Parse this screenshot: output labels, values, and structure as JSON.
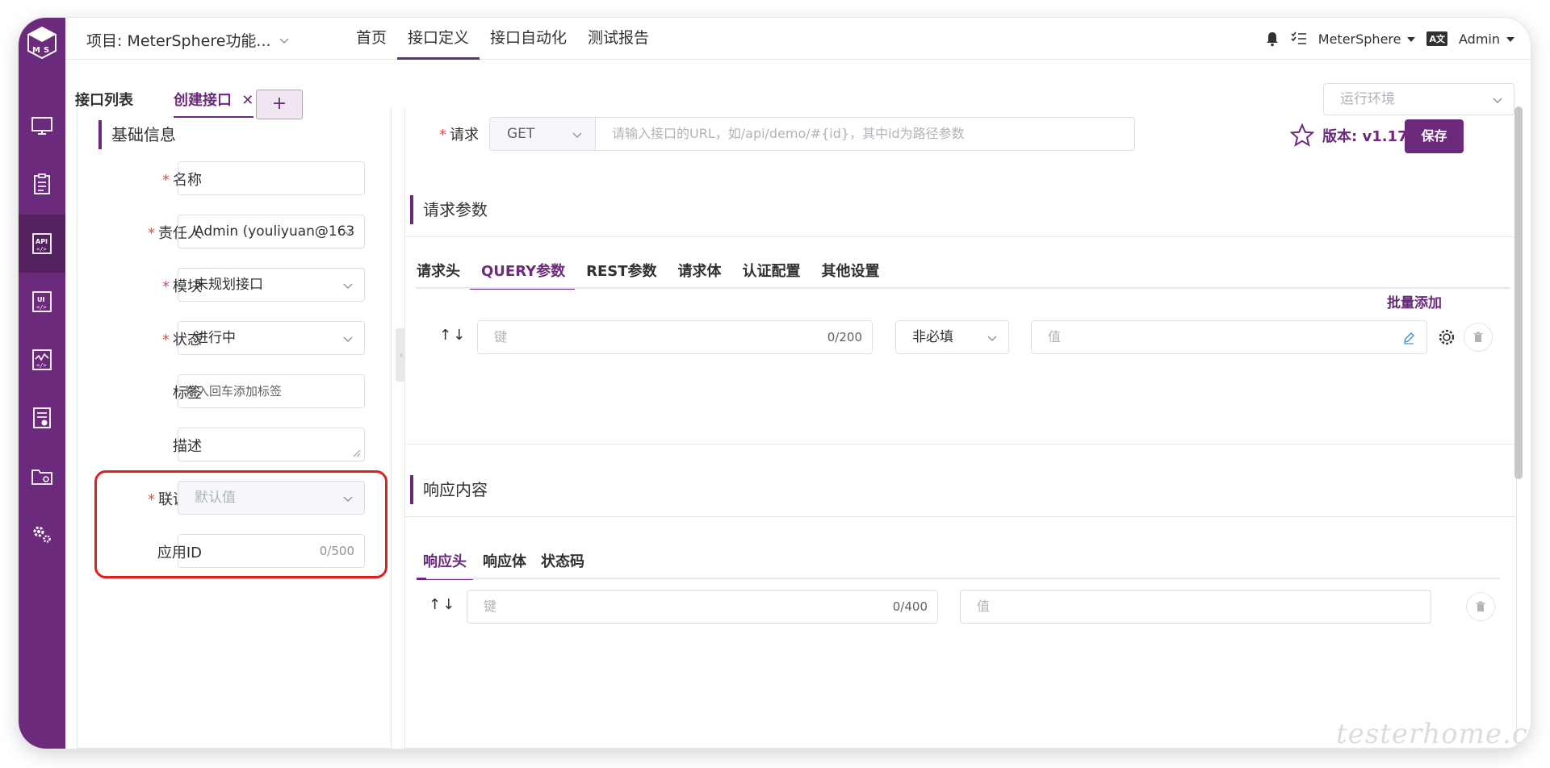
{
  "app": {
    "brand_color": "#6b2a7c",
    "sidebar_icons": [
      "monitor-icon",
      "clipboard-icon",
      "api-icon",
      "ui-icon",
      "performance-icon",
      "report-icon",
      "folder-icon",
      "settings-icon"
    ]
  },
  "header": {
    "project": "项目: MeterSphere功能...",
    "menu": [
      "首页",
      "接口定义",
      "接口自动化",
      "测试报告"
    ],
    "active_menu_index": 1,
    "workspace": "MeterSphere",
    "language_badge": "A文",
    "user": "Admin"
  },
  "tabs": {
    "list_label": "接口列表",
    "create_label": "创建接口",
    "close_glyph": "✕",
    "add_glyph": "+",
    "env_placeholder": "运行环境"
  },
  "basic_info": {
    "title": "基础信息",
    "fields": {
      "name": {
        "label": "名称",
        "value": ""
      },
      "owner": {
        "label": "责任人",
        "value": "Admin (youliyuan@163"
      },
      "module": {
        "label": "模块",
        "value": "未规划接口"
      },
      "status": {
        "label": "状态",
        "value": "进行中"
      },
      "tags": {
        "label": "标签",
        "placeholder": "输入回车添加标签"
      },
      "description": {
        "label": "描述",
        "value": ""
      },
      "contact": {
        "label": "联调人",
        "placeholder": "默认值"
      },
      "app_id": {
        "label": "应用ID",
        "counter": "0/500"
      }
    },
    "required_mark": "*"
  },
  "request": {
    "label": "请求",
    "method": "GET",
    "url_placeholder": "请输入接口的URL，如/api/demo/#{id}，其中id为路径参数",
    "version": "版本: v1.17",
    "save_label": "保存"
  },
  "request_params": {
    "title": "请求参数",
    "tabs": [
      "请求头",
      "QUERY参数",
      "REST参数",
      "请求体",
      "认证配置",
      "其他设置"
    ],
    "active_tab_index": 1,
    "batch_add": "批量添加",
    "sort_glyph": "↑↓",
    "row": {
      "key_placeholder": "键",
      "key_counter": "0/200",
      "required_select": "非必填",
      "value_placeholder": "值"
    }
  },
  "response": {
    "title": "响应内容",
    "tabs": [
      "响应头",
      "响应体",
      "状态码"
    ],
    "active_tab_index": 0,
    "sort_glyph": "↑↓",
    "row": {
      "key_placeholder": "键",
      "key_counter": "0/400",
      "value_placeholder": "值"
    }
  },
  "watermark": "testerhome.com"
}
